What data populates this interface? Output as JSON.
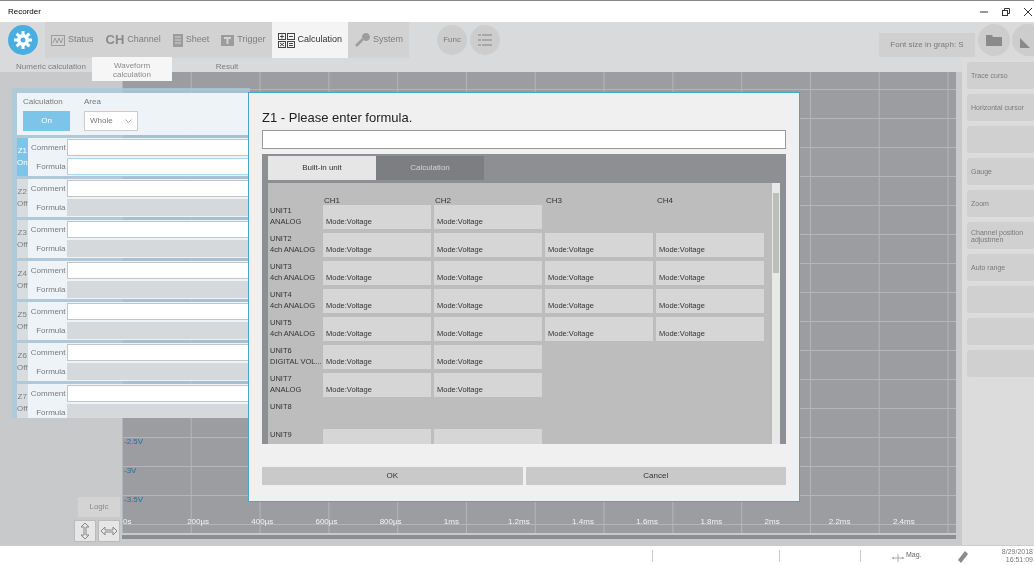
{
  "window": {
    "title": "Recorder"
  },
  "toolbar": {
    "tabs": [
      {
        "label": "Status",
        "kind": "wave",
        "selected": false
      },
      {
        "label": "Channel",
        "kind": "text",
        "icon_text": "CH",
        "selected": false
      },
      {
        "label": "Sheet",
        "kind": "sheet",
        "selected": false
      },
      {
        "label": "Trigger",
        "kind": "trigger",
        "selected": false
      },
      {
        "label": "Calculation",
        "kind": "calc",
        "selected": true
      },
      {
        "label": "System",
        "kind": "wrench",
        "selected": false
      }
    ],
    "func_button": "Func",
    "font_size_button": "Font size in graph: S"
  },
  "subtabs": [
    {
      "label": "Numeric calculation",
      "selected": false
    },
    {
      "label": "Waveform calculation",
      "selected": true
    },
    {
      "label": "Result",
      "selected": false
    }
  ],
  "graph": {
    "y_labels": [
      "-2.5V",
      "-3V",
      "-3.5V"
    ],
    "x_labels": [
      "0s",
      "200µs",
      "400µs",
      "600µs",
      "800µs",
      "1ms",
      "1.2ms",
      "1.4ms",
      "1.6ms",
      "1.8ms",
      "2ms",
      "2.2ms",
      "2.4ms"
    ],
    "logic_button": "Logic"
  },
  "side_buttons": [
    {
      "kind": "text",
      "label": "Trace curso"
    },
    {
      "kind": "text",
      "label": "Horizontal cursor"
    },
    {
      "kind": "blank"
    },
    {
      "kind": "text",
      "label": "Gauge"
    },
    {
      "kind": "text",
      "label": "Zoom"
    },
    {
      "kind": "text",
      "label": "Channel position adjustmen"
    },
    {
      "kind": "text",
      "label": "Auto range"
    },
    {
      "kind": "blank"
    },
    {
      "kind": "blank"
    },
    {
      "kind": "blank"
    }
  ],
  "calc_panel": {
    "calculation_label": "Calculation",
    "calculation_button": {
      "label": "On",
      "on": true
    },
    "area_label": "Area",
    "area_value": "Whole",
    "rows": [
      {
        "name": "Z1",
        "state": "On",
        "on": true,
        "comment_label": "Comment",
        "formula_label": "Formula"
      },
      {
        "name": "Z2",
        "state": "Off",
        "on": false,
        "comment_label": "Comment",
        "formula_label": "Formula"
      },
      {
        "name": "Z3",
        "state": "Off",
        "on": false,
        "comment_label": "Comment",
        "formula_label": "Formula"
      },
      {
        "name": "Z4",
        "state": "Off",
        "on": false,
        "comment_label": "Comment",
        "formula_label": "Formula"
      },
      {
        "name": "Z5",
        "state": "Off",
        "on": false,
        "comment_label": "Comment",
        "formula_label": "Formula"
      },
      {
        "name": "Z6",
        "state": "Off",
        "on": false,
        "comment_label": "Comment",
        "formula_label": "Formula"
      },
      {
        "name": "Z7",
        "state": "Off",
        "on": false,
        "comment_label": "Comment",
        "formula_label": "Formula"
      }
    ]
  },
  "dialog": {
    "title": "Z1 - Please enter formula.",
    "tabs": [
      {
        "label": "Built-in unit",
        "selected": true
      },
      {
        "label": "Calculation",
        "selected": false
      }
    ],
    "columns": [
      "CH1",
      "CH2",
      "CH3",
      "CH4"
    ],
    "rows": [
      {
        "unit": "UNIT1",
        "type": "ANALOG",
        "cells": [
          {
            "kind": "mode",
            "text": "Mode:Voltage"
          },
          {
            "kind": "mode",
            "text": "Mode:Voltage"
          }
        ]
      },
      {
        "unit": "UNIT2",
        "type": "4ch ANALOG",
        "cells": [
          {
            "kind": "mode",
            "text": "Mode:Voltage"
          },
          {
            "kind": "mode",
            "text": "Mode:Voltage"
          },
          {
            "kind": "mode",
            "text": "Mode:Voltage"
          },
          {
            "kind": "mode",
            "text": "Mode:Voltage"
          }
        ]
      },
      {
        "unit": "UNIT3",
        "type": "4ch ANALOG",
        "cells": [
          {
            "kind": "mode",
            "text": "Mode:Voltage"
          },
          {
            "kind": "mode",
            "text": "Mode:Voltage"
          },
          {
            "kind": "mode",
            "text": "Mode:Voltage"
          },
          {
            "kind": "mode",
            "text": "Mode:Voltage"
          }
        ]
      },
      {
        "unit": "UNIT4",
        "type": "4ch ANALOG",
        "cells": [
          {
            "kind": "mode",
            "text": "Mode:Voltage"
          },
          {
            "kind": "mode",
            "text": "Mode:Voltage"
          },
          {
            "kind": "mode",
            "text": "Mode:Voltage"
          },
          {
            "kind": "mode",
            "text": "Mode:Voltage"
          }
        ]
      },
      {
        "unit": "UNIT5",
        "type": "4ch ANALOG",
        "cells": [
          {
            "kind": "mode",
            "text": "Mode:Voltage"
          },
          {
            "kind": "mode",
            "text": "Mode:Voltage"
          },
          {
            "kind": "mode",
            "text": "Mode:Voltage"
          },
          {
            "kind": "mode",
            "text": "Mode:Voltage"
          }
        ]
      },
      {
        "unit": "UNIT6",
        "type": "DIGITAL VOL...",
        "cells": [
          {
            "kind": "mode",
            "text": "Mode:Voltage"
          },
          {
            "kind": "mode",
            "text": "Mode:Voltage"
          }
        ]
      },
      {
        "unit": "UNIT7",
        "type": "ANALOG",
        "cells": [
          {
            "kind": "mode",
            "text": "Mode:Voltage"
          },
          {
            "kind": "mode",
            "text": "Mode:Voltage"
          }
        ]
      },
      {
        "unit": "UNIT8",
        "cells": []
      },
      {
        "unit": "UNIT9",
        "cells": [
          {
            "kind": "blank"
          },
          {
            "kind": "blank"
          }
        ]
      }
    ],
    "buttons": [
      "OK",
      "Cancel"
    ]
  },
  "status_bar": {
    "mag_label": "Mag.",
    "date": "8/29/2018",
    "time": "16:51:09"
  }
}
